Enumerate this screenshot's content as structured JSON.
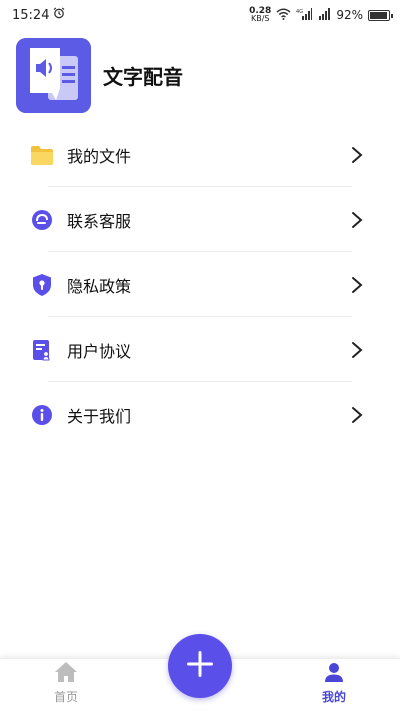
{
  "status_bar": {
    "time": "15:24",
    "net_speed_value": "0.28",
    "net_speed_unit": "KB/S",
    "battery_text": "92%",
    "battery_level": 0.92
  },
  "app": {
    "title": "文字配音",
    "brand_color": "#5b5be6"
  },
  "menu": {
    "items": [
      {
        "label": "我的文件",
        "icon": "folder-icon"
      },
      {
        "label": "联系客服",
        "icon": "customer-service-icon"
      },
      {
        "label": "隐私政策",
        "icon": "privacy-shield-icon"
      },
      {
        "label": "用户协议",
        "icon": "user-agreement-icon"
      },
      {
        "label": "关于我们",
        "icon": "info-icon"
      }
    ]
  },
  "bottom_nav": {
    "home_label": "首页",
    "mine_label": "我的",
    "active_tab": "我的",
    "active_color": "#4b47d6",
    "fab_icon": "plus-icon"
  }
}
